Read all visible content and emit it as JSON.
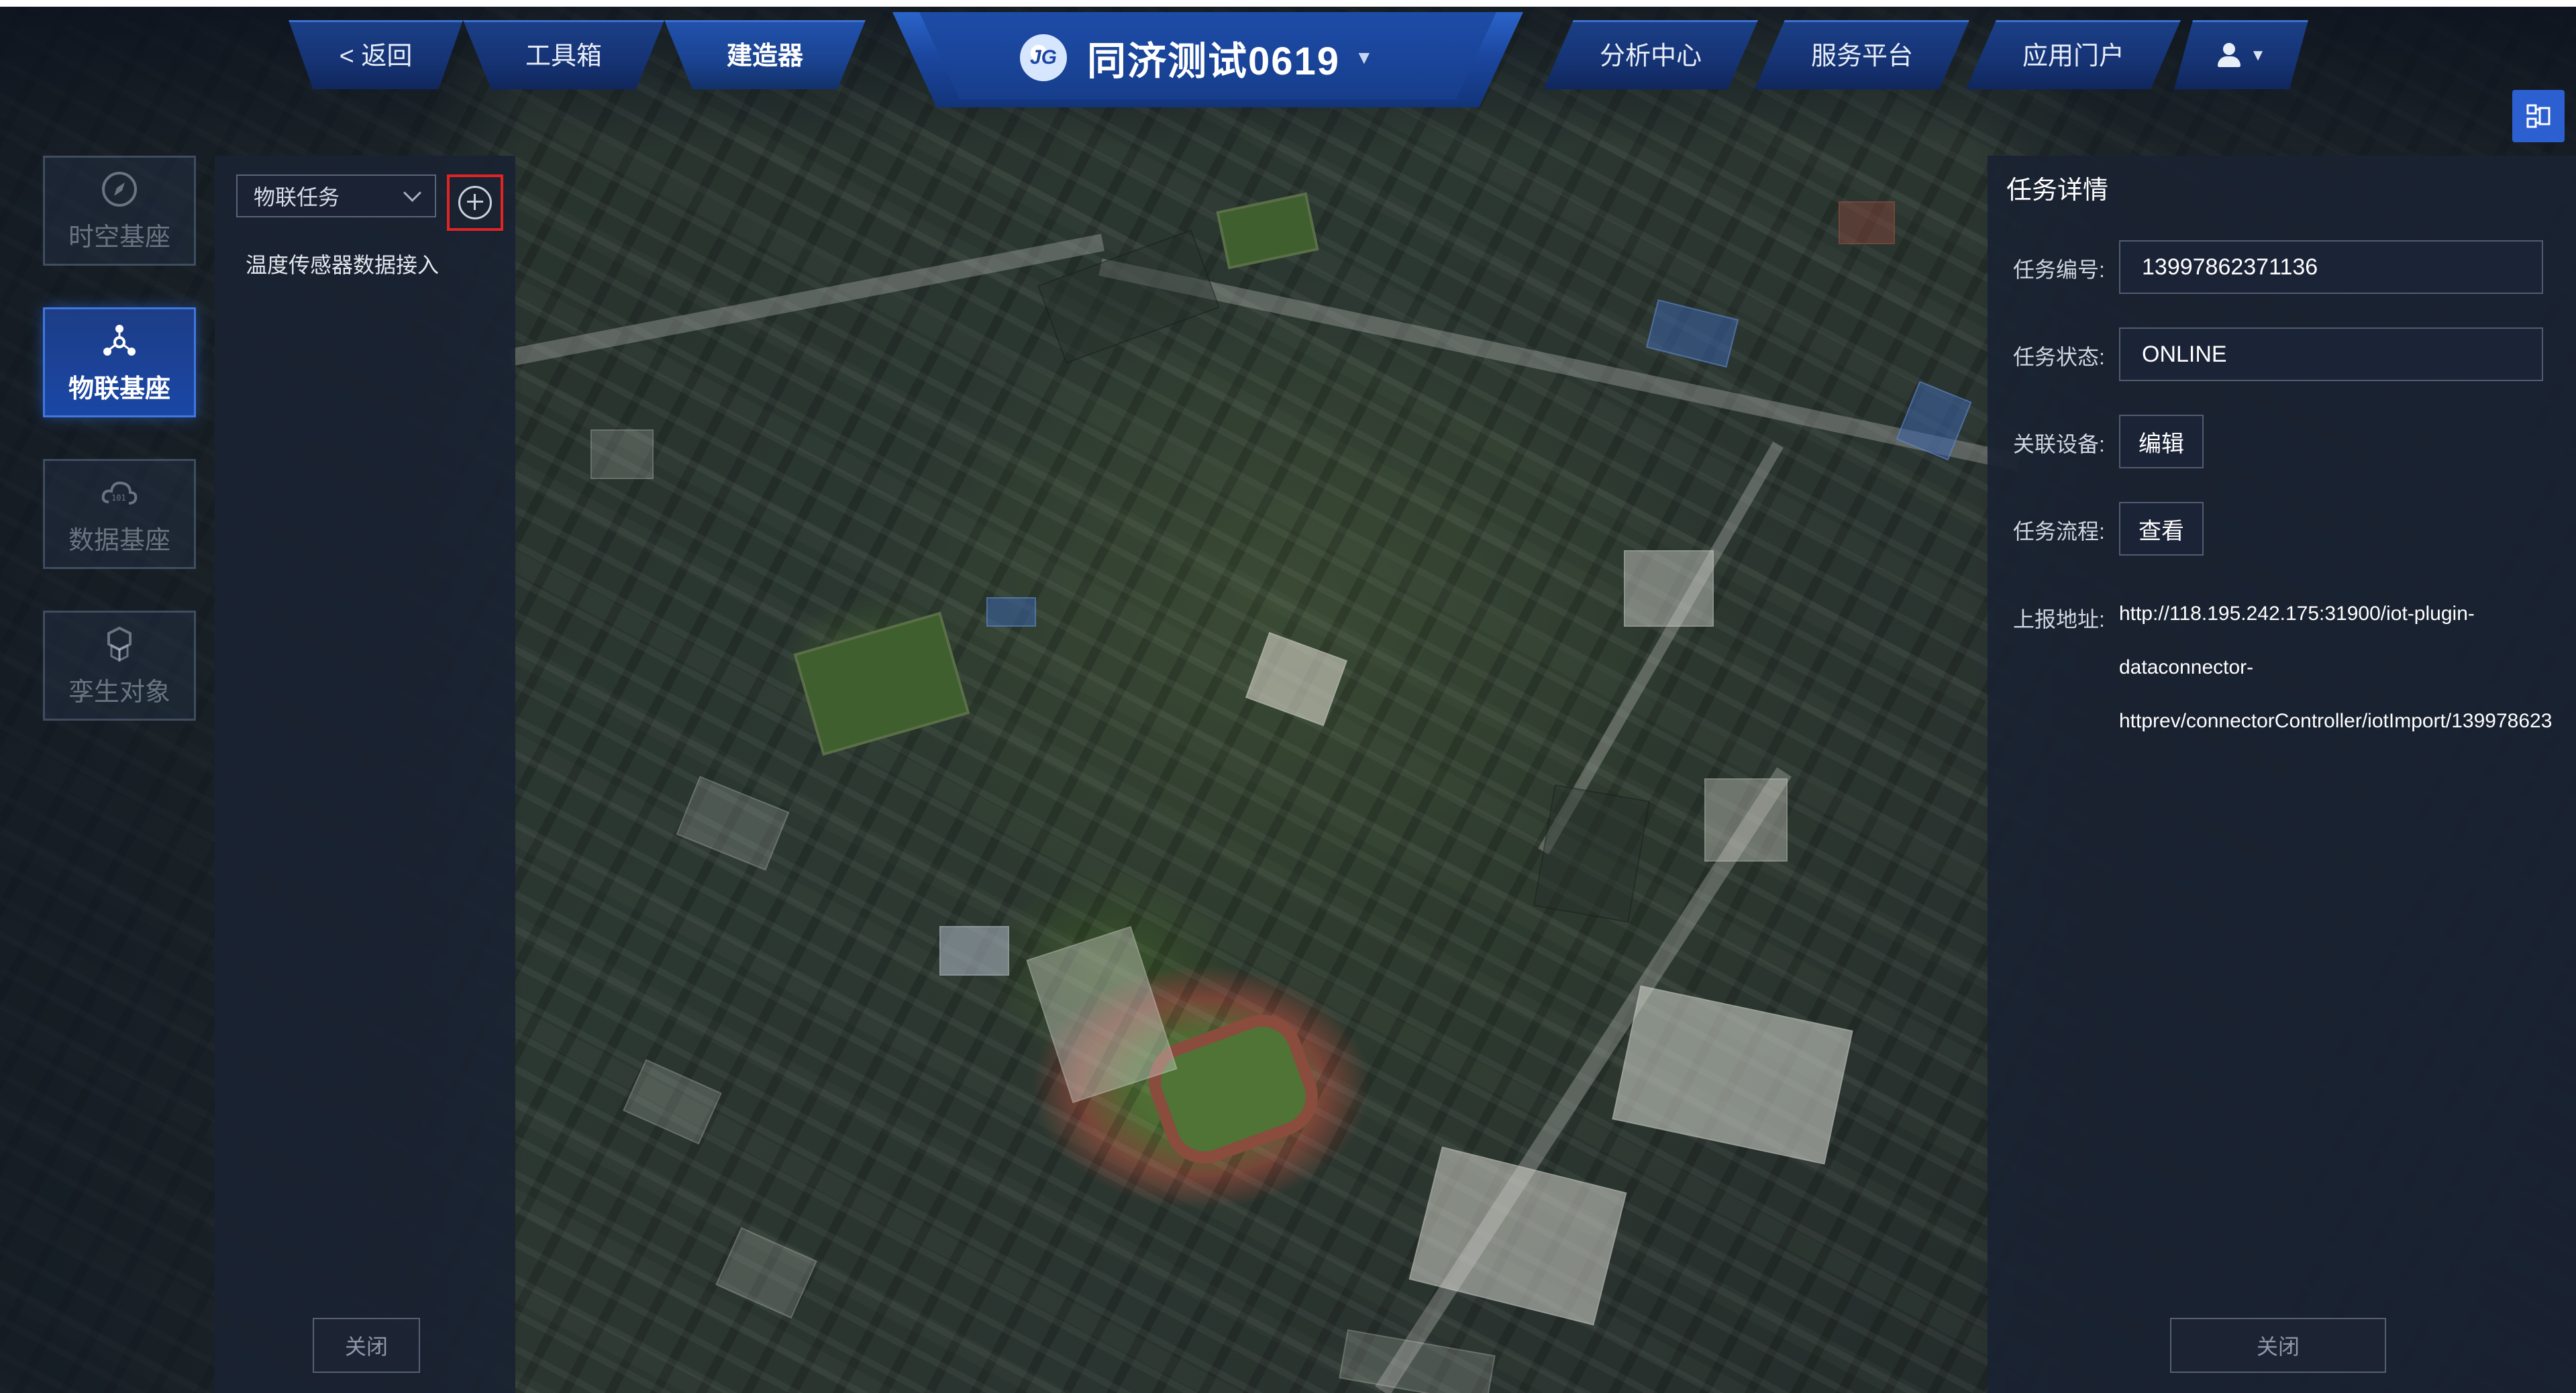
{
  "app": {
    "title": "同济测试0619",
    "logo_text": "JG"
  },
  "nav": {
    "back": "< 返回",
    "toolbox": "工具箱",
    "builder": "建造器",
    "analysis": "分析中心",
    "service": "服务平台",
    "portal": "应用门户"
  },
  "rail": {
    "items": [
      {
        "label": "时空基座",
        "icon": "compass-icon",
        "active": false
      },
      {
        "label": "物联基座",
        "icon": "network-nodes-icon",
        "active": true
      },
      {
        "label": "数据基座",
        "icon": "binary-cloud-icon",
        "active": false
      },
      {
        "label": "孪生对象",
        "icon": "cubes-icon",
        "active": false
      }
    ]
  },
  "left_panel": {
    "select_value": "物联任务",
    "tasks": [
      "温度传感器数据接入"
    ],
    "close_label": "关闭"
  },
  "task_detail": {
    "title": "任务详情",
    "id_label": "任务编号:",
    "id_value": "13997862371136",
    "status_label": "任务状态:",
    "status_value": "ONLINE",
    "device_label": "关联设备:",
    "device_button": "编辑",
    "flow_label": "任务流程:",
    "flow_button": "查看",
    "url_label": "上报地址:",
    "url_lines": [
      "http://118.195.242.175:31900/iot-plugin-",
      "dataconnector-",
      "httprev/connectorController/iotImport/139978623"
    ],
    "close_label": "关闭"
  },
  "colors": {
    "accent": "#2c5fd0",
    "nav": "#163476",
    "highlight": "#e02424"
  }
}
